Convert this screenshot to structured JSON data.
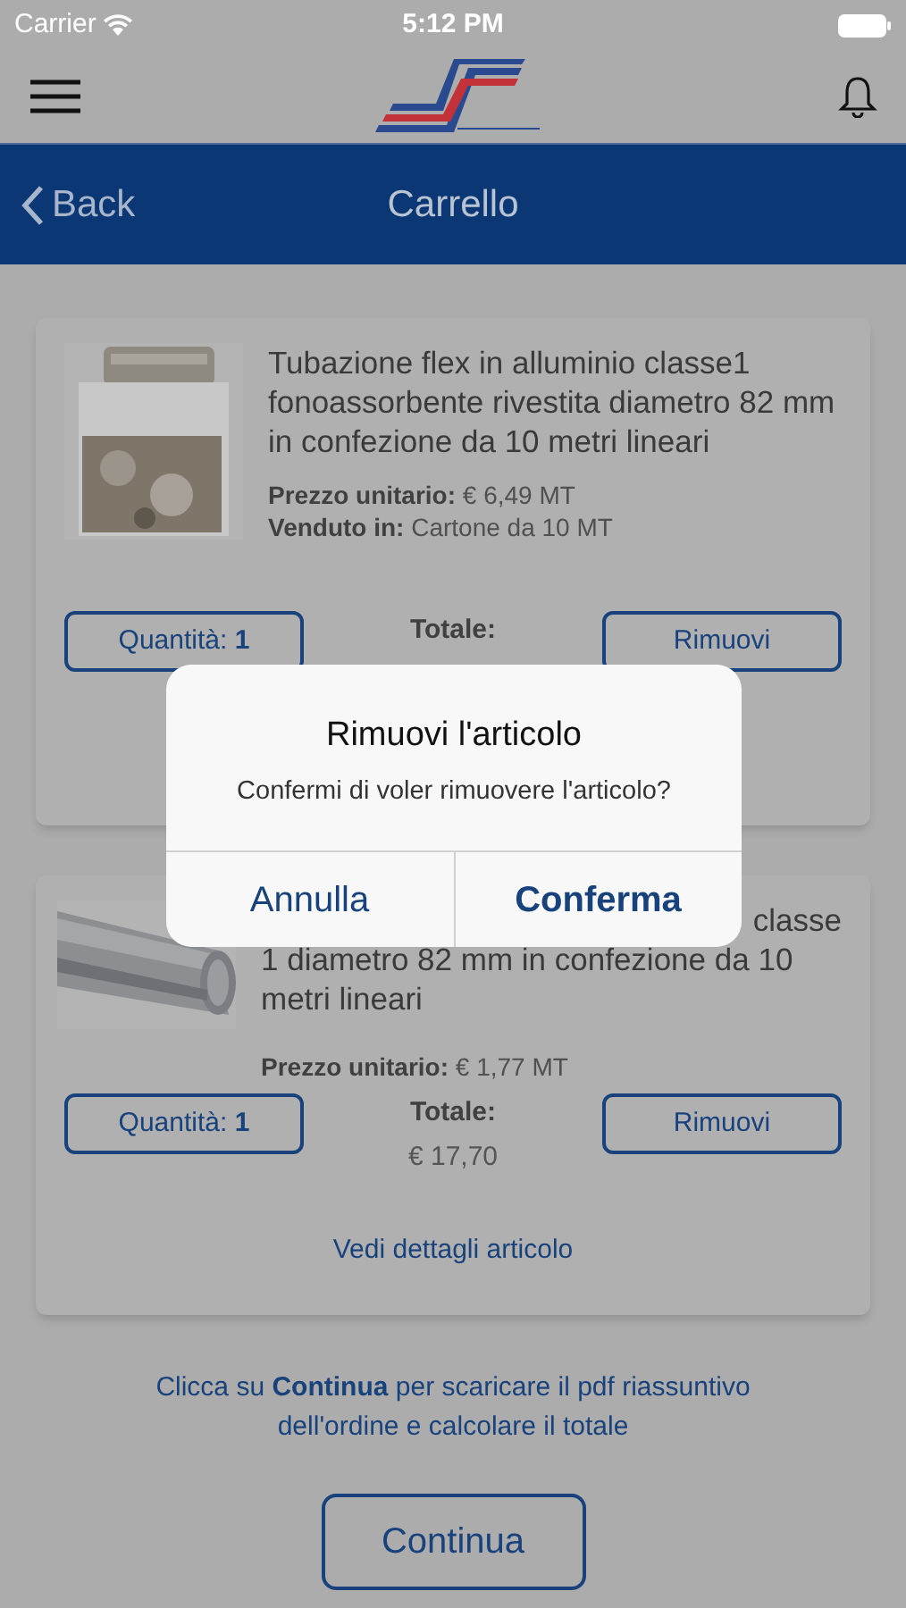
{
  "status_bar": {
    "carrier": "Carrier",
    "time": "5:12 PM"
  },
  "nav": {
    "back": "Back",
    "title": "Carrello"
  },
  "items": [
    {
      "title": "Tubazione flex in alluminio classe1 fonoassorbente rivestita diametro 82 mm in confezione da 10 metri lineari",
      "price_label": "Prezzo unitario:",
      "price": "€ 6,49 MT",
      "sold_label": "Venduto in:",
      "sold": "Cartone da 10 MT",
      "quantity_label": "Quantità:",
      "quantity": "1",
      "total_label": "Totale:",
      "remove": "Rimuovi"
    },
    {
      "title_first_line_end": "classe",
      "title_rest": "1 diametro 82 mm in confezione da 10 metri lineari",
      "price_label": "Prezzo unitario:",
      "price": "€ 1,77 MT",
      "quantity_label": "Quantità:",
      "quantity": "1",
      "total_label": "Totale:",
      "total": "€ 17,70",
      "remove": "Rimuovi",
      "details": "Vedi dettagli articolo"
    }
  ],
  "hint": "Clicca su **Continua** per scaricare il pdf riassuntivo dell'ordine e calcolare il totale",
  "continue": "Continua",
  "dialog": {
    "title": "Rimuovi l'articolo",
    "message": "Confermi di voler rimuovere l'articolo?",
    "cancel": "Annulla",
    "confirm": "Conferma"
  }
}
